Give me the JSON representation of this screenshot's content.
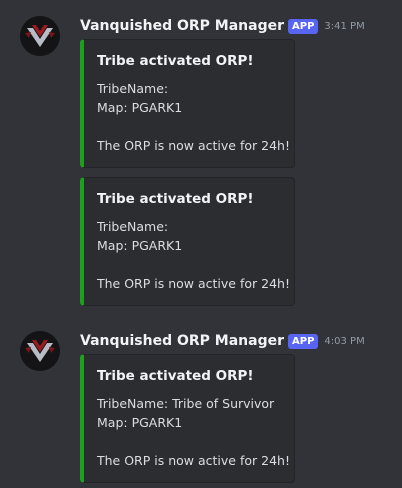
{
  "colors": {
    "background": "#323339",
    "embed_background": "#2b2d31",
    "embed_accent": "#1ea01e",
    "app_badge": "#5865f2"
  },
  "messages": [
    {
      "author": "Vanquished ORP Manager",
      "badge": "APP",
      "time": "3:41 PM",
      "avatar_icon": "vanquished-logo-icon",
      "embeds": [
        {
          "title": "Tribe activated ORP!",
          "lines": [
            "TribeName:",
            "Map: PGARK1",
            "",
            "The ORP is now active for 24h!"
          ]
        },
        {
          "title": "Tribe activated ORP!",
          "lines": [
            "TribeName:",
            "Map: PGARK1",
            "",
            "The ORP is now active for 24h!"
          ]
        }
      ]
    },
    {
      "author": "Vanquished ORP Manager",
      "badge": "APP",
      "time": "4:03 PM",
      "avatar_icon": "vanquished-logo-icon",
      "embeds": [
        {
          "title": "Tribe activated ORP!",
          "lines": [
            "TribeName: Tribe of Survivor",
            "Map: PGARK1",
            "",
            "The ORP is now active for 24h!"
          ]
        }
      ]
    }
  ]
}
